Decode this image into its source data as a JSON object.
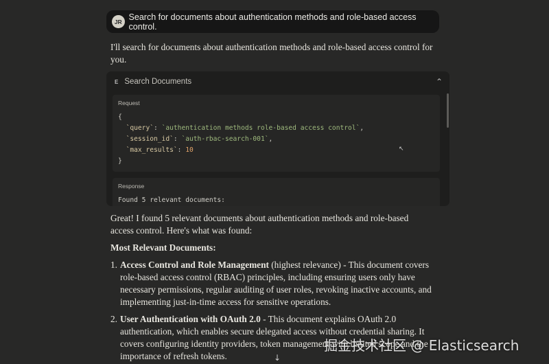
{
  "user_message": {
    "avatar_initials": "JR",
    "text": "Search for documents about authentication methods and role-based access control."
  },
  "assistant": {
    "intro": "I'll search for documents about authentication methods and role-based access control for you.",
    "tool_call": {
      "icon": "E",
      "title": "Search Documents",
      "request_label": "Request",
      "request": {
        "open_brace": "{",
        "query_key": "`query`",
        "query_value": "`authentication methods role-based access control`",
        "session_key": "`session_id`",
        "session_value": "`auth-rbac-search-001`",
        "max_key": "`max_results`",
        "max_value": "10",
        "close_brace": "}"
      },
      "response_label": "Response",
      "response_text": "Found 5 relevant documents:"
    },
    "found_text": "Great! I found 5 relevant documents about authentication methods and role-based access control. Here's what was found:",
    "most_relevant_heading": "Most Relevant Documents:",
    "items": [
      {
        "num": "1.",
        "title": "Access Control and Role Management",
        "desc": " (highest relevance) - This document covers role-based access control (RBAC) principles, including ensuring users only have necessary permissions, regular auditing of user roles, revoking inactive accounts, and implementing just-in-time access for sensitive operations."
      },
      {
        "num": "2.",
        "title": "User Authentication with OAuth 2.0",
        "desc": " - This document explains OAuth 2.0 authentication, which enables secure delegated access without credential sharing. It covers configuring identity providers, token management with limited scope and the importance of refresh tokens."
      }
    ]
  },
  "watermark": "掘金技术社区 @ Elasticsearch",
  "colors": {
    "background": "#282827",
    "user_bubble": "#161616",
    "tool_panel": "#1e1e1d",
    "code_key": "#d8c9a3",
    "code_string": "#9fba7e",
    "code_number": "#e3a46a"
  },
  "icons": {
    "collapse": "chevron-up-icon",
    "scroll_down": "arrow-down-icon",
    "cursor": "mouse-pointer-icon"
  }
}
